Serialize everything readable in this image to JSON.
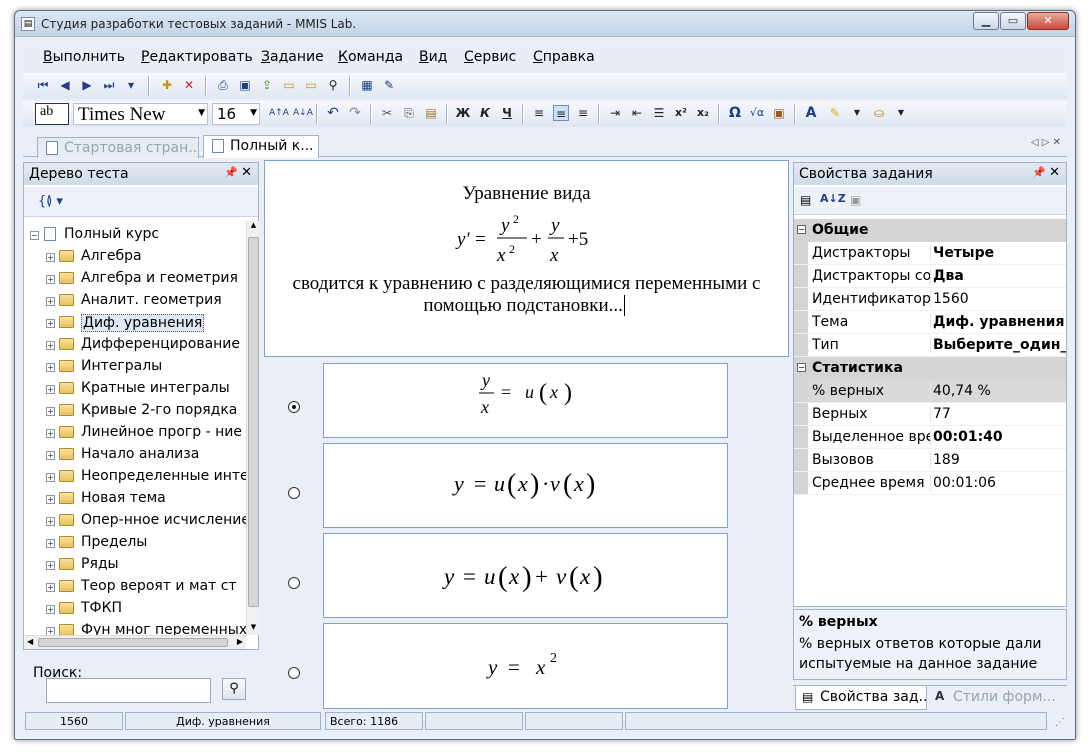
{
  "window": {
    "title": "Студия разработки тестовых заданий - MMIS Lab.",
    "min": "▁",
    "max": "▭",
    "close": "✕"
  },
  "menu": [
    "Выполнить",
    "Редактировать",
    "Задание",
    "Команда",
    "Вид",
    "Сервис",
    "Справка"
  ],
  "font_toolbar": {
    "font_name": "Times New",
    "font_size": "16",
    "style_bold": "Ж",
    "style_italic": "К",
    "style_underline": "Ч"
  },
  "doc_tabs": [
    "Стартовая стран...",
    "Полный к..."
  ],
  "tree_panel": {
    "title": "Дерево теста",
    "root": "Полный курс",
    "items": [
      "Алгебра",
      "Алгебра и геометрия",
      "Аналит. геометрия",
      "Диф. уравнения",
      "Дифференцирование",
      "Интегралы",
      "Кратные интегралы",
      "Кривые 2-го порядка",
      "Линейное прогр - ние",
      "Начало анализа",
      "Неопределенные инте",
      "Новая тема",
      "Опер-нное исчисление",
      "Пределы",
      "Ряды",
      "Теор вероят и мат ст",
      "ТФКП",
      "Фун мног переменных"
    ],
    "selected_index": 3,
    "search_label": "Поиск:",
    "search_value": ""
  },
  "question": {
    "line1": "Уравнение вида",
    "line2": "сводится к уравнению с разделяющимися переменными с",
    "line3": "помощью подстановки..."
  },
  "answers": {
    "selected_index": 0
  },
  "properties_panel": {
    "title": "Свойства задания",
    "categories": [
      {
        "name": "Общие",
        "rows": [
          {
            "name": "Дистракторы",
            "value": "Четыре",
            "bold": true
          },
          {
            "name": "Дистракторы сос",
            "value": "Два",
            "bold": true
          },
          {
            "name": "Идентификатор",
            "value": "1560",
            "bold": false
          },
          {
            "name": "Тема",
            "value": "Диф. уравнения",
            "bold": true
          },
          {
            "name": "Тип",
            "value": "Выберите_один_из",
            "bold": true
          }
        ]
      },
      {
        "name": "Статистика",
        "rows": [
          {
            "name": "% верных",
            "value": "40,74 %",
            "bold": false
          },
          {
            "name": "Верных",
            "value": "77",
            "bold": false
          },
          {
            "name": "Выделенное вре",
            "value": "00:01:40",
            "bold": true
          },
          {
            "name": "Вызовов",
            "value": "189",
            "bold": false
          },
          {
            "name": "Среднее время",
            "value": "00:01:06",
            "bold": false
          }
        ]
      }
    ],
    "description_title": "% верных",
    "description_text": "% верных ответов которые дали испытуемые на данное задание",
    "bottom_tabs": [
      "Свойства зад...",
      "Стили форм..."
    ]
  },
  "status": {
    "id": "1560",
    "topic": "Диф. уравнения",
    "total": "Всего: 1186"
  }
}
